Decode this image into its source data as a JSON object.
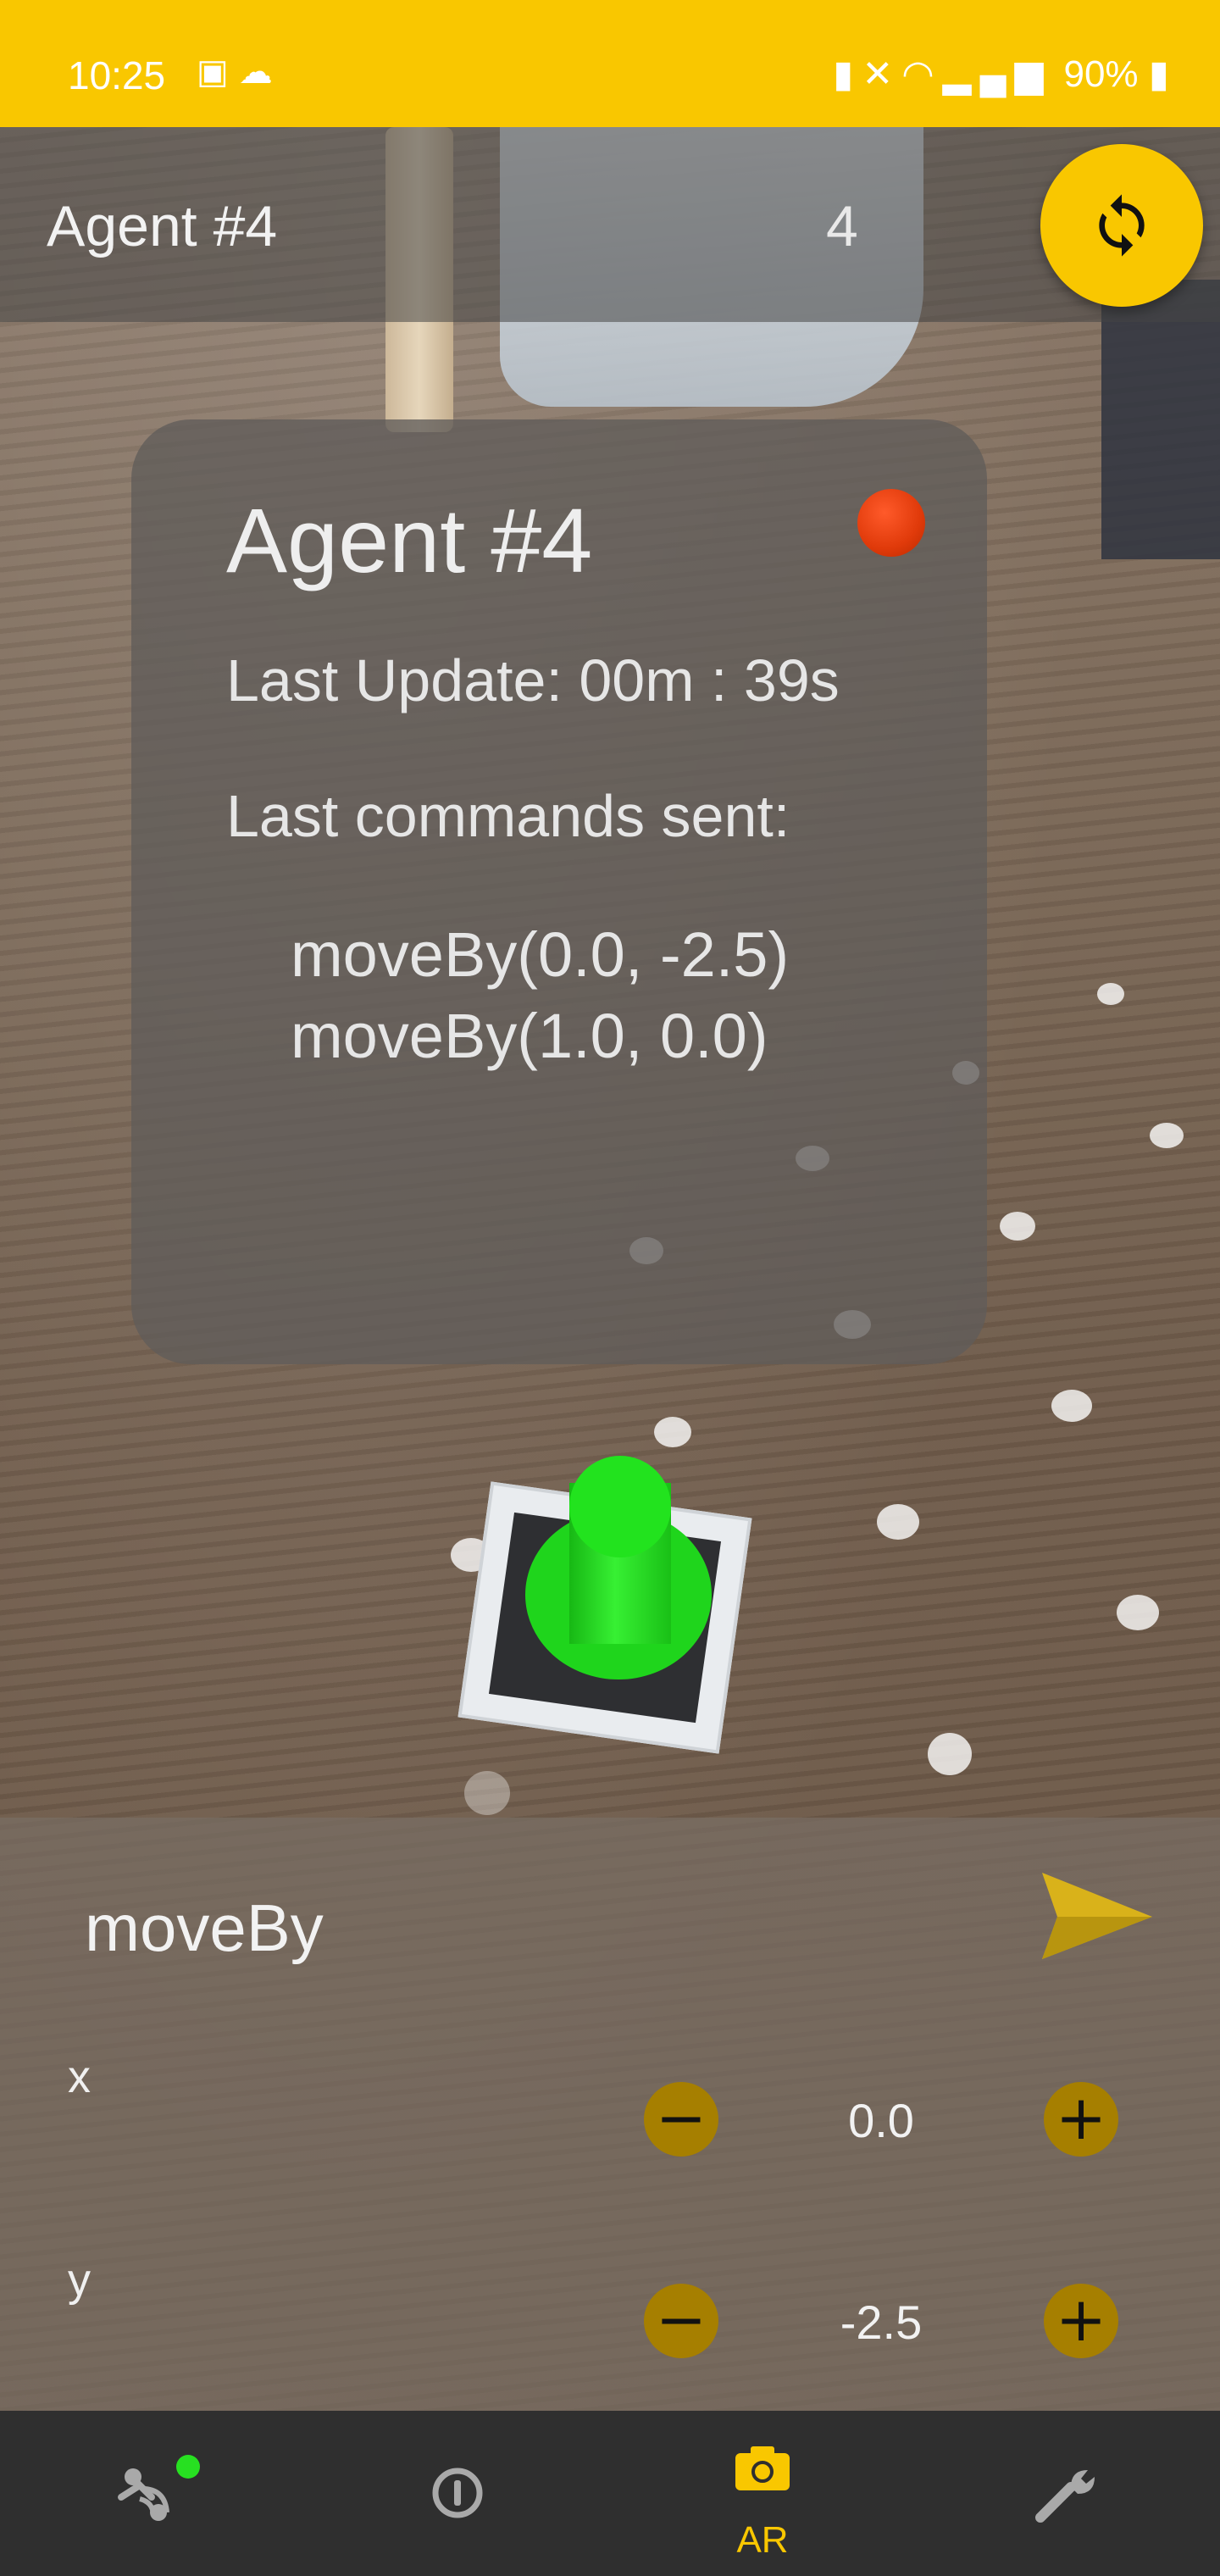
{
  "status_bar": {
    "time": "10:25",
    "battery": "90%",
    "left_icons": [
      "image-icon",
      "cloud-icon"
    ],
    "right_icons": [
      "battery-saver-icon",
      "mute-icon",
      "wifi-icon",
      "signal-icon",
      "battery-icon"
    ]
  },
  "app_bar": {
    "title": "Agent #4",
    "count": "4",
    "sync_button_icon": "sync-icon"
  },
  "agent_card": {
    "title": "Agent #4",
    "status_color": "#e8400c",
    "last_update": "Last Update: 00m : 39s",
    "commands_label": "Last commands sent:",
    "commands": [
      "moveBy(0.0, -2.5)",
      "moveBy(1.0, 0.0)"
    ]
  },
  "command_panel": {
    "name": "moveBy",
    "send_icon": "send-icon",
    "params": [
      {
        "label": "x",
        "value": "0.0"
      },
      {
        "label": "y",
        "value": "-2.5"
      }
    ],
    "decrement_symbol": "−",
    "increment_symbol": "+"
  },
  "bottom_nav": {
    "items": [
      {
        "icon": "agents-connected-icon",
        "label": ""
      },
      {
        "icon": "info-icon",
        "label": ""
      },
      {
        "icon": "camera-icon",
        "label": "AR"
      },
      {
        "icon": "wrench-icon",
        "label": ""
      }
    ],
    "active_color": "#f9c700",
    "connection_status_color": "#27e021"
  },
  "colors": {
    "accent": "#f9c700"
  }
}
